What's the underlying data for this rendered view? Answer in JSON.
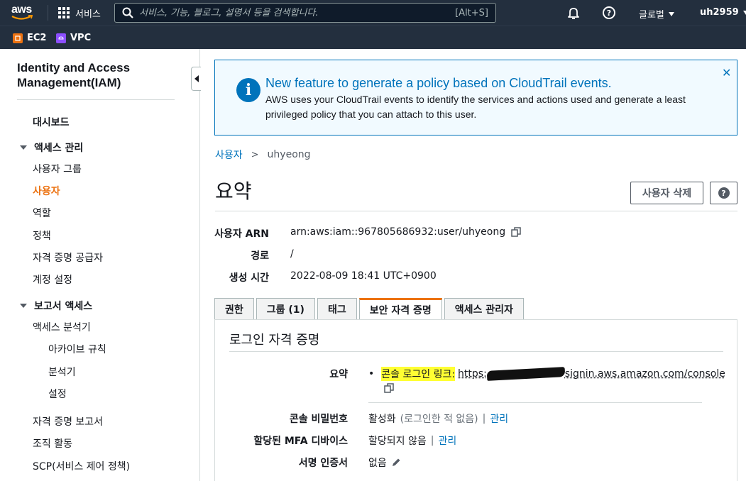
{
  "topbar": {
    "logo_text": "aws",
    "services_label": "서비스",
    "search_placeholder": "서비스, 기능, 블로그, 설명서 등을 검색합니다.",
    "search_shortcut": "[Alt+S]",
    "help_glyph": "?",
    "region_label": "글로벌",
    "user_label": "uh2959"
  },
  "favorites": [
    {
      "label": "EC2",
      "color": "#ec7211"
    },
    {
      "label": "VPC",
      "color": "#8c4fff"
    }
  ],
  "sidebar": {
    "title": "Identity and Access Management(IAM)",
    "dashboard": "대시보드",
    "access_mgmt": {
      "heading": "액세스 관리",
      "items": [
        "사용자 그룹",
        "사용자",
        "역할",
        "정책",
        "자격 증명 공급자",
        "계정 설정"
      ],
      "active_index": 1
    },
    "reports": {
      "heading": "보고서 액세스",
      "analyzer": "액세스 분석기",
      "analyzer_items": [
        "아카이브 규칙",
        "분석기",
        "설정"
      ],
      "items": [
        "자격 증명 보고서",
        "조직 활동",
        "SCP(서비스 제어 정책)"
      ]
    }
  },
  "banner": {
    "icon_glyph": "i",
    "title": "New feature to generate a policy based on CloudTrail events.",
    "body": "AWS uses your CloudTrail events to identify the services and actions used and generate a least privileged policy that you can attach to this user.",
    "close_glyph": "✕"
  },
  "breadcrumb": {
    "parent": "사용자",
    "separator": ">",
    "current": "uhyeong"
  },
  "summary": {
    "title": "요약",
    "delete_button": "사용자 삭제",
    "help_glyph": "?",
    "fields": [
      {
        "label": "사용자 ARN",
        "value": "arn:aws:iam::967805686932:user/uhyeong"
      },
      {
        "label": "경로",
        "value": "/"
      },
      {
        "label": "생성 시간",
        "value": "2022-08-09 18:41 UTC+0900"
      }
    ]
  },
  "tabs": [
    "권한",
    "그룹 (1)",
    "태그",
    "보안 자격 증명",
    "액세스 관리자"
  ],
  "active_tab": 3,
  "credentials": {
    "title": "로그인 자격 증명",
    "summary_label": "요약",
    "bullet": "•",
    "console_link_label": "콘솔 로그인 링크:",
    "console_link_prefix": "https:",
    "console_link_suffix": "signin.aws.amazon.com/console",
    "rows": [
      {
        "label": "콘솔 비밀번호",
        "value": "활성화",
        "note": "(로그인한 적 없음)",
        "sep": "|",
        "link": "관리"
      },
      {
        "label": "할당된 MFA 디바이스",
        "value": "할당되지 않음",
        "sep": "|",
        "link": "관리"
      },
      {
        "label": "서명 인증서",
        "value": "없음"
      }
    ]
  },
  "colors": {
    "nav_bg": "#232f3e",
    "accent_orange": "#ec7211",
    "link_blue": "#0073bb",
    "highlight": "#ffff33"
  }
}
